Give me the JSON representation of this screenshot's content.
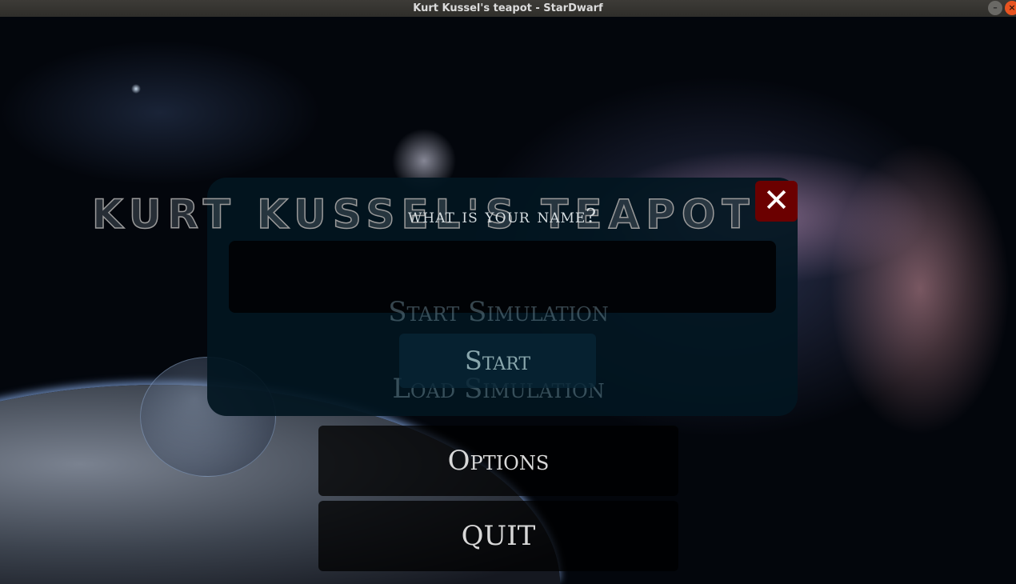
{
  "window": {
    "title": "Kurt Kussel's teapot - StarDwarf",
    "minimize_icon": "–",
    "close_icon": "×"
  },
  "logo": {
    "text": "Kurt Kussel's Teapot"
  },
  "menu": {
    "start_simulation": "Start Simulation",
    "load_simulation": "Load Simulation",
    "options": "Options",
    "quit": "QUIT"
  },
  "dialog": {
    "title": "What is your name?",
    "name_value": "",
    "start": "Start",
    "close_icon": "✕"
  }
}
